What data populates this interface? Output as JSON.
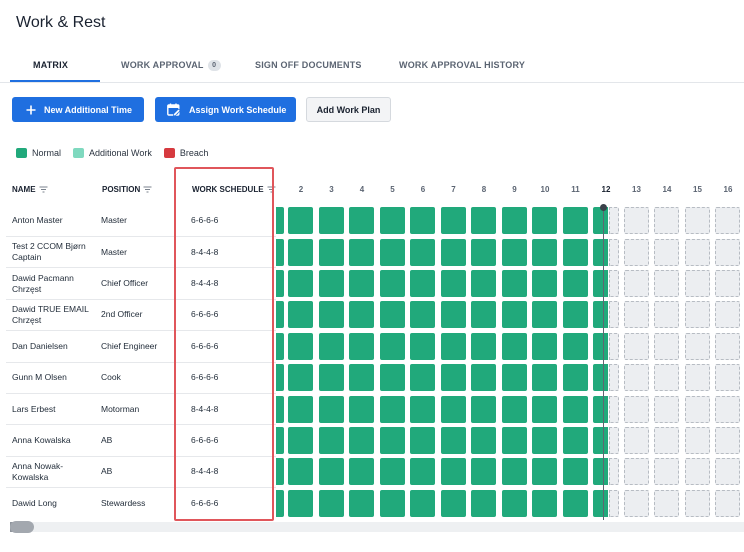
{
  "page": {
    "title": "Work & Rest"
  },
  "tabs": [
    {
      "label": "MATRIX",
      "active": true
    },
    {
      "label": "WORK APPROVAL",
      "badge": "0"
    },
    {
      "label": "SIGN OFF DOCUMENTS"
    },
    {
      "label": "WORK APPROVAL HISTORY"
    }
  ],
  "toolbar": {
    "new_additional_time": "New Additional Time",
    "assign_work_schedule": "Assign Work Schedule",
    "add_work_plan": "Add Work Plan"
  },
  "legend": [
    {
      "label": "Normal",
      "color": "#21a97b"
    },
    {
      "label": "Additional Work",
      "color": "#7fd9bf"
    },
    {
      "label": "Breach",
      "color": "#d63a3f"
    }
  ],
  "columns": {
    "name": "NAME",
    "position": "POSITION",
    "schedule": "WORK SCHEDULE"
  },
  "days": [
    "2",
    "3",
    "4",
    "5",
    "6",
    "7",
    "8",
    "9",
    "10",
    "11",
    "12",
    "13",
    "14",
    "15",
    "16"
  ],
  "current_day": "12",
  "filled_days_count": 11,
  "rows": [
    {
      "name": "Anton Master",
      "position": "Master",
      "schedule": "6-6-6-6"
    },
    {
      "name": "Test 2 CCOM Bjørn Captain",
      "position": "Master",
      "schedule": "8-4-4-8"
    },
    {
      "name": "Dawid Pacmann Chrzęst",
      "position": "Chief Officer",
      "schedule": "8-4-4-8"
    },
    {
      "name": "Dawid TRUE EMAIL Chrzęst",
      "position": "2nd Officer",
      "schedule": "6-6-6-6"
    },
    {
      "name": "Dan Danielsen",
      "position": "Chief Engineer",
      "schedule": "6-6-6-6"
    },
    {
      "name": "Gunn M Olsen",
      "position": "Cook",
      "schedule": "6-6-6-6"
    },
    {
      "name": "Lars Erbest",
      "position": "Motorman",
      "schedule": "8-4-4-8"
    },
    {
      "name": "Anna Kowalska",
      "position": "AB",
      "schedule": "6-6-6-6"
    },
    {
      "name": "Anna Nowak-Kowalska",
      "position": "AB",
      "schedule": "8-4-4-8"
    },
    {
      "name": "Dawid Long",
      "position": "Stewardess",
      "schedule": "6-6-6-6"
    }
  ],
  "icons": {
    "plus": "plus-icon",
    "calendar_edit": "calendar-edit-icon",
    "filter": "filter-icon"
  }
}
